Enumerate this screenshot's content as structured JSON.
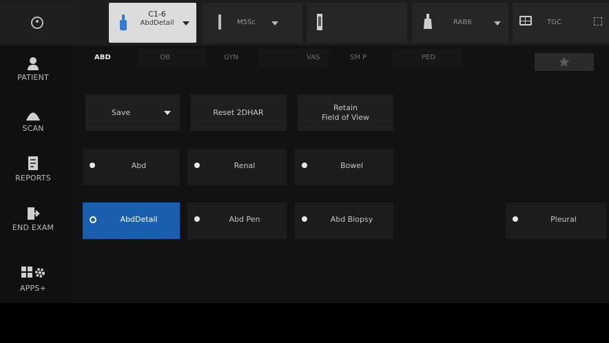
{
  "topbar": {
    "probe_active": {
      "name": "C1-6",
      "preset": "AbdDetail"
    },
    "probe_2": {
      "name": "M5Sc"
    },
    "probe_4": {
      "name": "RAB6"
    },
    "tgc_label": "TGC"
  },
  "sidebar": {
    "items": [
      {
        "label": "PATIENT",
        "icon": "patient-icon"
      },
      {
        "label": "SCAN",
        "icon": "scan-icon"
      },
      {
        "label": "REPORTS",
        "icon": "reports-icon"
      },
      {
        "label": "END EXAM",
        "icon": "end-exam-icon"
      },
      {
        "label": "APPS+",
        "icon": "apps-icon"
      }
    ]
  },
  "tabs": [
    {
      "label": "ABD",
      "active": true
    },
    {
      "label": "OB"
    },
    {
      "label": "GYN"
    },
    {
      "label": "VAS"
    },
    {
      "label": "SM P"
    },
    {
      "label": "PED"
    }
  ],
  "actions": {
    "save_label": "Save",
    "reset_label": "Reset 2DHAR",
    "retain_line1": "Retain",
    "retain_line2": "Field of View"
  },
  "presets": {
    "row1": [
      "Abd",
      "Renal",
      "Bowel"
    ],
    "row2": [
      "AbdDetail",
      "Abd Pen",
      "Abd Biopsy"
    ],
    "extra": "Pleural",
    "active": "AbdDetail"
  },
  "colors": {
    "accent": "#1a5fae",
    "probe_icon": "#2f7bd6"
  }
}
